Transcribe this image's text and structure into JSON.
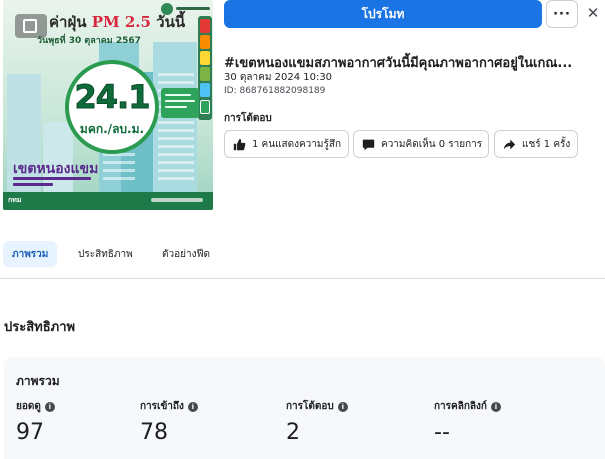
{
  "thumbnail": {
    "title_prefix": "ค่าฝุ่น",
    "title_pm": "PM 2.5",
    "title_suffix": "วันนี้",
    "date_line": "วันพุธที่ 30 ตุลาคม 2567",
    "value": "24.1",
    "unit": "มคก./ลบ.ม.",
    "district": "เขตหนองแขม",
    "brand": "กทม",
    "meter_colors": [
      "#e53935",
      "#fb8c00",
      "#fdd835",
      "#7cb342",
      "#4fc3f7"
    ]
  },
  "toolbar": {
    "promote_label": "โปรโมท",
    "more_label": "···",
    "close_label": "✕"
  },
  "post": {
    "title": "#เขตหนองแขมสภาพอากาศวันนี้มีคุณภาพอากาศอยู่ในเกณ...",
    "date": "30 ตุลาคม 2024 10:30",
    "id": "ID: 868761882098189"
  },
  "reactions": {
    "label": "การโต้ตอบ",
    "like_label": "1 คนแสดงความรู้สึก",
    "comment_label": "ความคิดเห็น 0 รายการ",
    "share_label": "แชร์ 1 ครั้ง"
  },
  "tabs": [
    {
      "label": "ภาพรวม"
    },
    {
      "label": "ประสิทธิภาพ"
    },
    {
      "label": "ตัวอย่างฟีด"
    }
  ],
  "performance": {
    "section_title": "ประสิทธิภาพ",
    "overview_title": "ภาพรวม",
    "metrics": [
      {
        "label": "ยอดดู",
        "value": "97"
      },
      {
        "label": "การเข้าถึง",
        "value": "78"
      },
      {
        "label": "การโต้ตอบ",
        "value": "2"
      },
      {
        "label": "การคลิกลิงก์",
        "value": "--"
      }
    ],
    "info_glyph": "i"
  },
  "colors": {
    "primary": "#1b74e4",
    "tab_active_bg": "#e7f3ff",
    "tab_active_text": "#1b5fb7"
  }
}
